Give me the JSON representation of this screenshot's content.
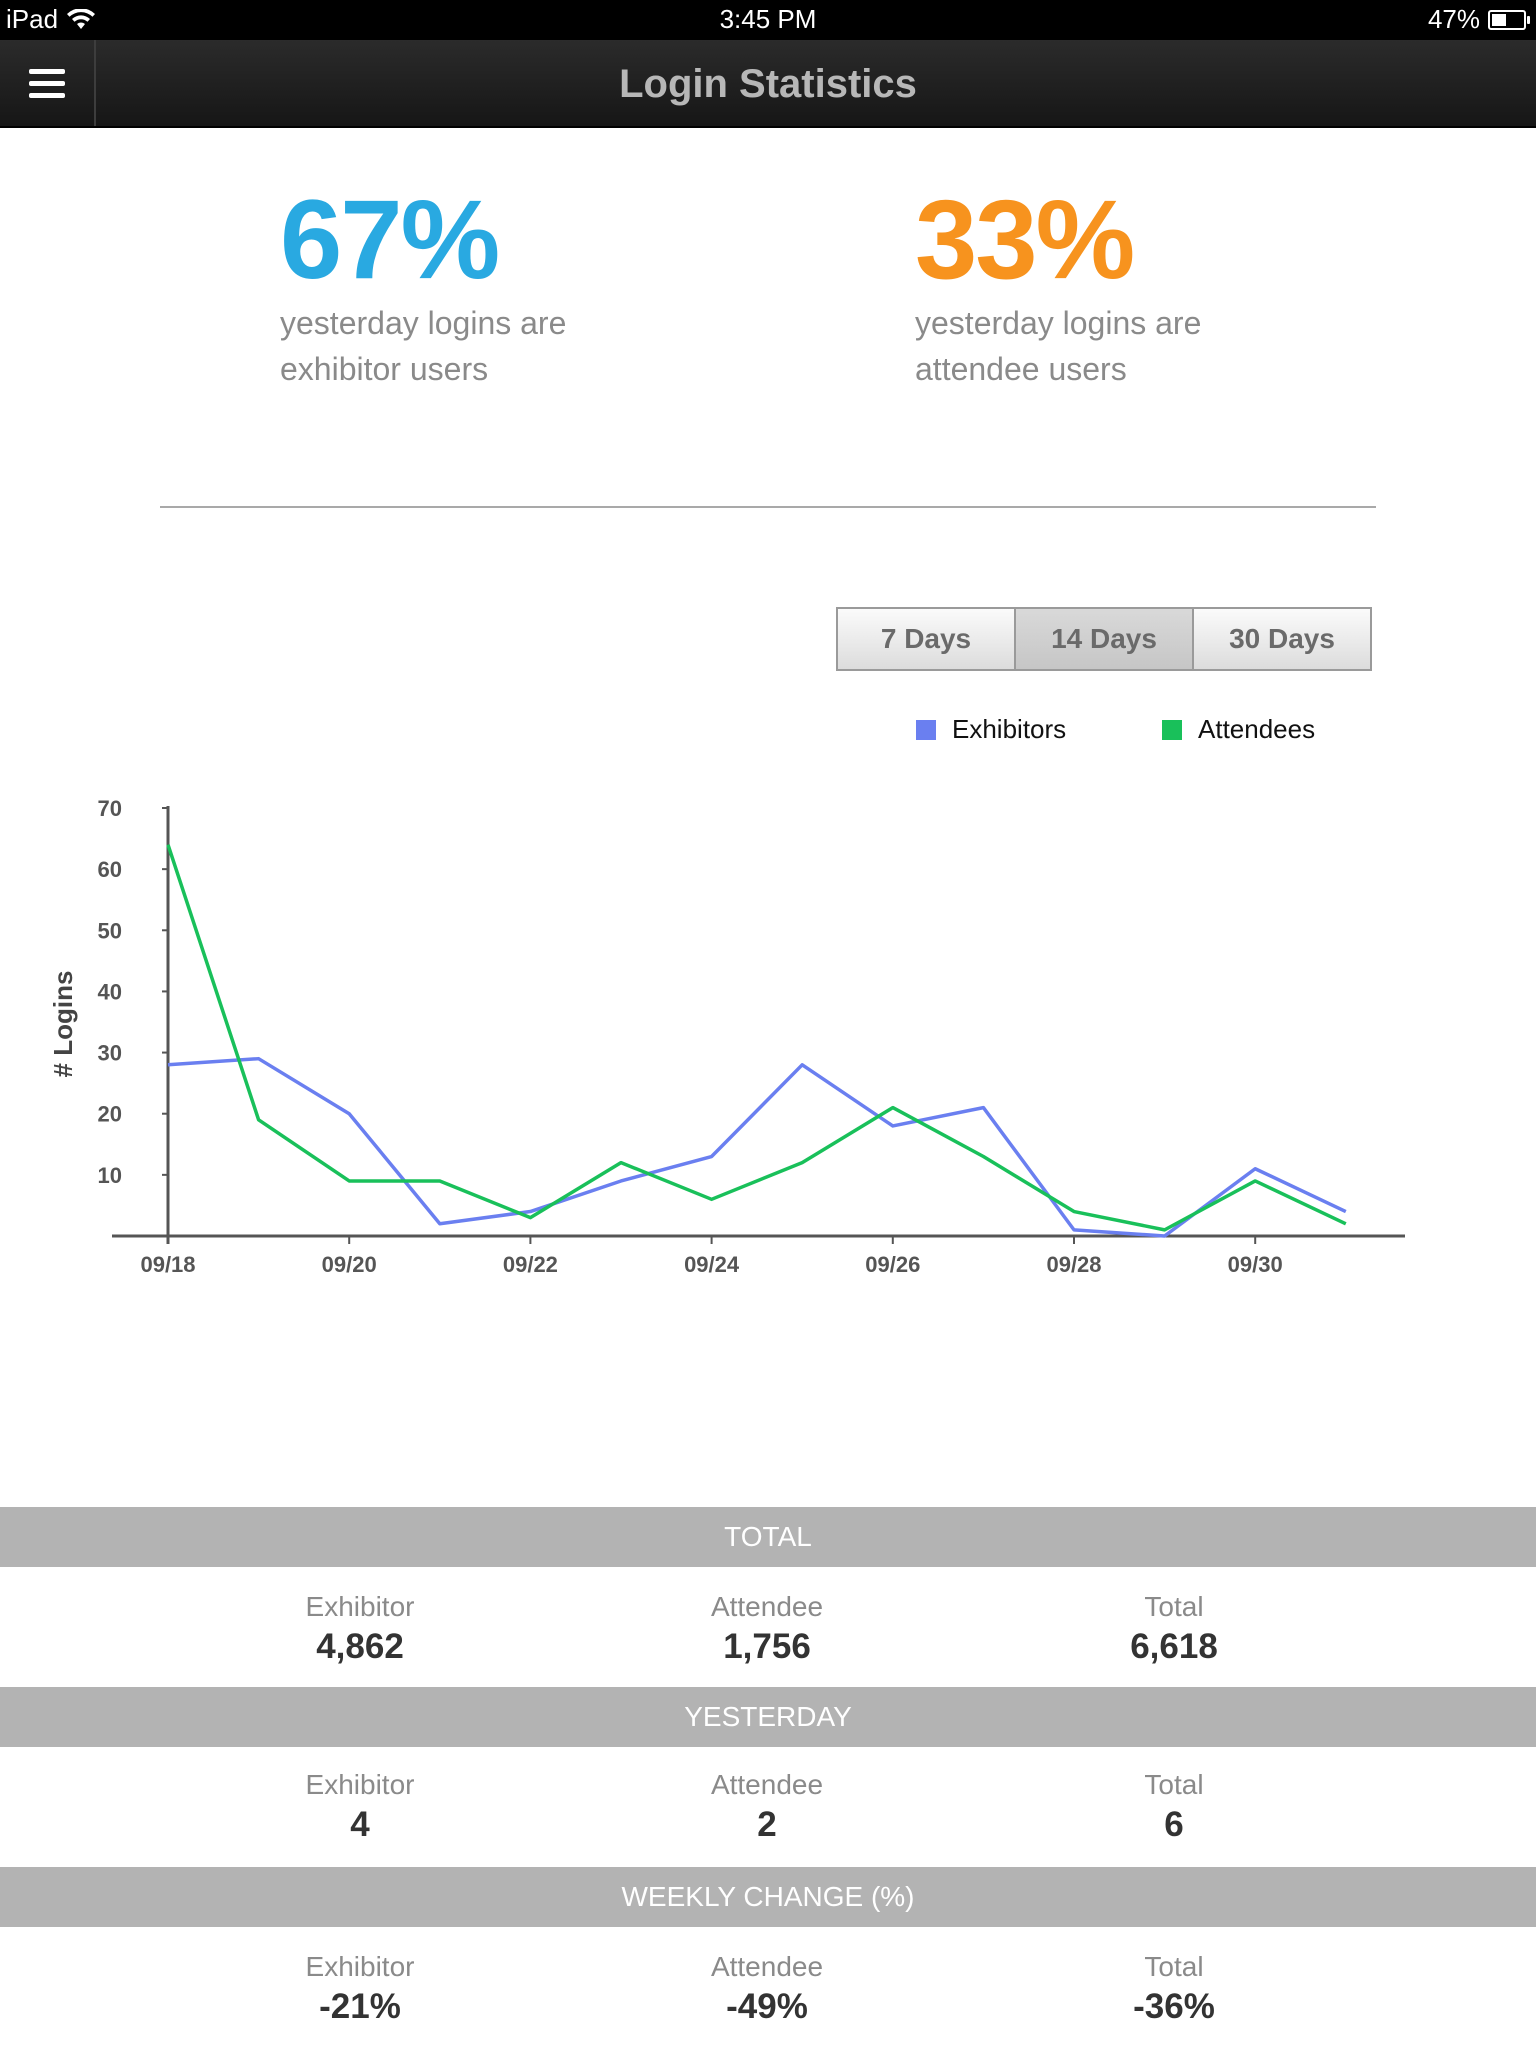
{
  "status_bar": {
    "device": "iPad",
    "time": "3:45 PM",
    "battery": "47%",
    "battery_level": 0.47
  },
  "nav": {
    "title": "Login Statistics"
  },
  "stats": {
    "exhibitor": {
      "percent": "67%",
      "desc_line1": "yesterday logins are",
      "desc_line2": "exhibitor users",
      "color": "#29a9e1"
    },
    "attendee": {
      "percent": "33%",
      "desc_line1": "yesterday logins are",
      "desc_line2": "attendee users",
      "color": "#f7931e"
    }
  },
  "range_tabs": [
    {
      "label": "7 Days",
      "active": false
    },
    {
      "label": "14 Days",
      "active": true
    },
    {
      "label": "30 Days",
      "active": false
    }
  ],
  "legend": {
    "exhibitors": {
      "label": "Exhibitors",
      "color": "#6a7ff0"
    },
    "attendees": {
      "label": "Attendees",
      "color": "#19c05a"
    }
  },
  "chart_data": {
    "type": "line",
    "ylabel": "# Logins",
    "xlabel": "",
    "ylim": [
      0,
      70
    ],
    "yticks": [
      10,
      20,
      30,
      40,
      50,
      60,
      70
    ],
    "x": [
      "09/18",
      "09/19",
      "09/20",
      "09/21",
      "09/22",
      "09/23",
      "09/24",
      "09/25",
      "09/26",
      "09/27",
      "09/28",
      "09/29",
      "09/30",
      "10/01"
    ],
    "xtick_labels": [
      "09/18",
      "09/20",
      "09/22",
      "09/24",
      "09/26",
      "09/28",
      "09/30"
    ],
    "series": [
      {
        "name": "Exhibitors",
        "color": "#6a7ff0",
        "values": [
          28,
          29,
          20,
          2,
          4,
          9,
          13,
          28,
          18,
          21,
          1,
          0,
          11,
          4
        ]
      },
      {
        "name": "Attendees",
        "color": "#19c05a",
        "values": [
          64,
          19,
          9,
          9,
          3,
          12,
          6,
          12,
          21,
          13,
          4,
          1,
          9,
          2
        ]
      }
    ]
  },
  "tables": [
    {
      "header": "TOTAL",
      "cells": [
        {
          "label": "Exhibitor",
          "value": "4,862"
        },
        {
          "label": "Attendee",
          "value": "1,756"
        },
        {
          "label": "Total",
          "value": "6,618"
        }
      ]
    },
    {
      "header": "YESTERDAY",
      "cells": [
        {
          "label": "Exhibitor",
          "value": "4"
        },
        {
          "label": "Attendee",
          "value": "2"
        },
        {
          "label": "Total",
          "value": "6"
        }
      ]
    },
    {
      "header": "WEEKLY CHANGE (%)",
      "cells": [
        {
          "label": "Exhibitor",
          "value": "-21%"
        },
        {
          "label": "Attendee",
          "value": "-49%"
        },
        {
          "label": "Total",
          "value": "-36%"
        }
      ]
    }
  ]
}
